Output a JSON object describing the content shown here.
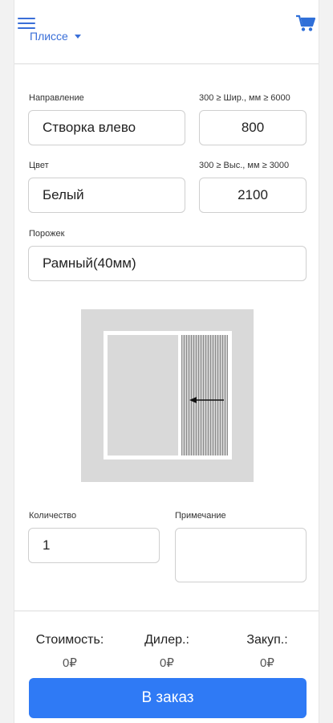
{
  "header": {
    "product_label": "Плиссе",
    "icons": {
      "menu": "menu-icon",
      "cart": "cart-icon"
    },
    "accent_color": "#3a6fd8"
  },
  "form": {
    "direction": {
      "label": "Направление",
      "value": "Створка влево"
    },
    "width": {
      "label": "300 ≥ Шир., мм ≥ 6000",
      "value": "800"
    },
    "color": {
      "label": "Цвет",
      "value": "Белый"
    },
    "height": {
      "label": "300 ≥ Выс., мм ≥ 3000",
      "value": "2100"
    },
    "threshold": {
      "label": "Порожек",
      "value": "Рамный(40мм)"
    },
    "quantity": {
      "label": "Количество",
      "value": "1"
    },
    "note": {
      "label": "Примечание",
      "value": ""
    }
  },
  "footer": {
    "cost": {
      "label": "Стоимость:",
      "value": "0₽"
    },
    "dealer": {
      "label": "Дилер.:",
      "value": "0₽"
    },
    "purchase": {
      "label": "Закуп.:",
      "value": "0₽"
    },
    "order_button": "В заказ",
    "button_color": "#2f7af5"
  }
}
